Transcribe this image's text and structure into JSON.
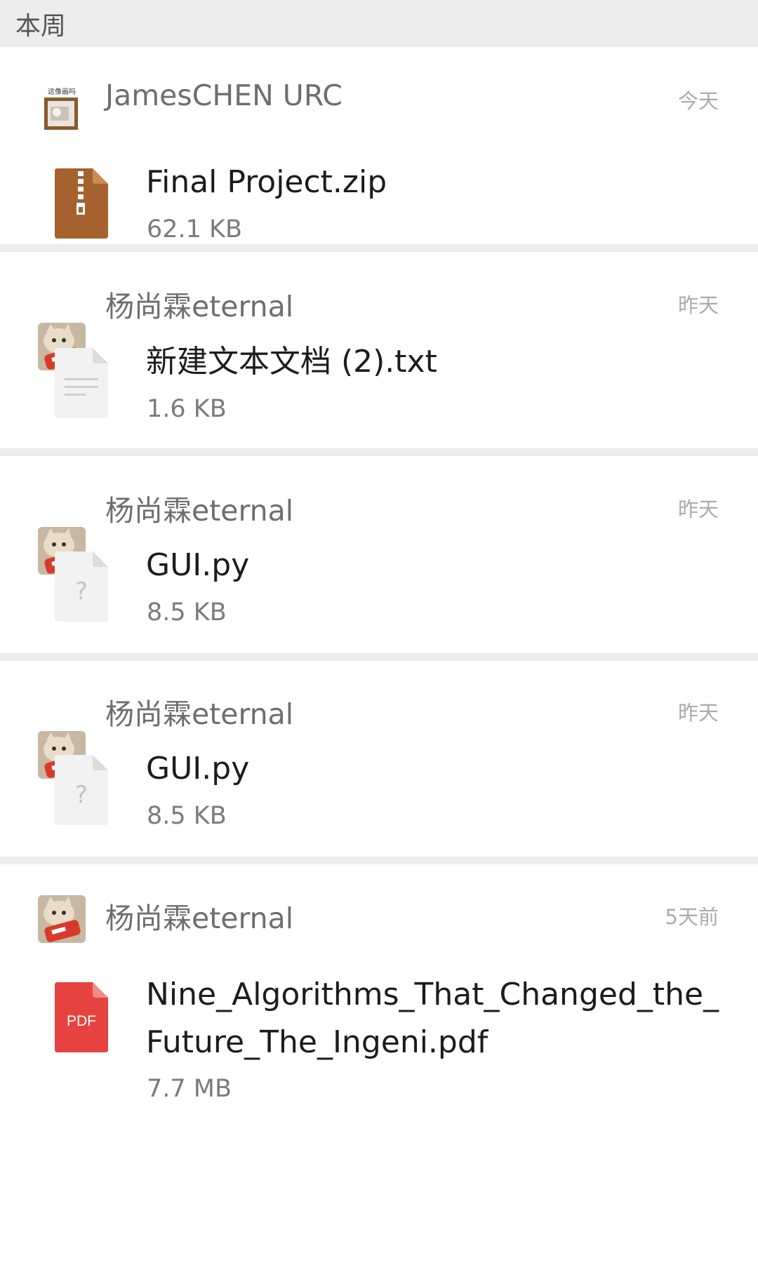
{
  "section": {
    "title": "本周"
  },
  "items": [
    {
      "sender": "JamesCHEN URC",
      "date": "今天",
      "avatar_icon": "framed-picture-avatar",
      "avatar_caption": "这像画吗",
      "file_icon": "zip-archive-icon",
      "file_name": "Final Project.zip",
      "file_size": "62.1 KB"
    },
    {
      "sender": "杨尚霖eternal",
      "date": "昨天",
      "avatar_icon": "cat-with-can-avatar",
      "file_icon": "text-document-icon",
      "file_name": "新建文本文档 (2).txt",
      "file_size": "1.6 KB"
    },
    {
      "sender": "杨尚霖eternal",
      "date": "昨天",
      "avatar_icon": "cat-with-can-avatar",
      "file_icon": "unknown-file-icon",
      "file_icon_glyph": "?",
      "file_name": "GUI.py",
      "file_size": "8.5 KB"
    },
    {
      "sender": "杨尚霖eternal",
      "date": "昨天",
      "avatar_icon": "cat-with-can-avatar",
      "file_icon": "unknown-file-icon",
      "file_icon_glyph": "?",
      "file_name": "GUI.py",
      "file_size": "8.5 KB"
    },
    {
      "sender": "杨尚霖eternal",
      "date": "5天前",
      "avatar_icon": "cat-with-can-avatar",
      "file_icon": "pdf-file-icon",
      "file_icon_label": "PDF",
      "file_name": "Nine_Algorithms_That_Changed_the_Future_The_Ingeni.pdf",
      "file_size": "7.7 MB"
    }
  ],
  "colors": {
    "background": "#ededed",
    "card": "#ffffff",
    "zip_brown": "#a5622e",
    "pdf_red": "#e64340",
    "generic_file": "#f2f2f2"
  }
}
